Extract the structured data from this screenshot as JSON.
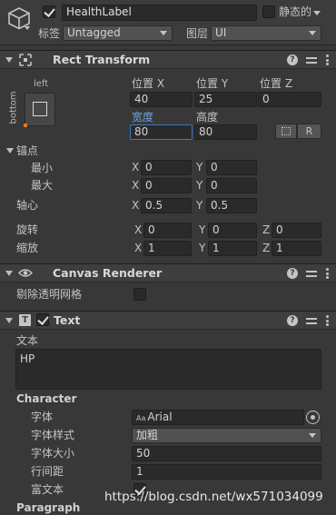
{
  "header": {
    "name_value": "HealthLabel",
    "static_label": "静态的",
    "tag_label": "标签",
    "tag_value": "Untagged",
    "layer_label": "图层",
    "layer_value": "UI"
  },
  "rect_transform": {
    "title": "Rect Transform",
    "anchor_preset_top": "left",
    "anchor_preset_side": "bottom",
    "pos_x_label": "位置 X",
    "pos_y_label": "位置 Y",
    "pos_z_label": "位置 Z",
    "pos_x": "40",
    "pos_y": "25",
    "pos_z": "0",
    "width_label": "宽度",
    "height_label": "高度",
    "width": "80",
    "height": "80",
    "raw_button": "R",
    "anchors_label": "锚点",
    "min_label": "最小",
    "max_label": "最大",
    "min_x": "0",
    "min_y": "0",
    "max_x": "0",
    "max_y": "0",
    "pivot_label": "轴心",
    "pivot_x": "0.5",
    "pivot_y": "0.5",
    "rotation_label": "旋转",
    "rot_x": "0",
    "rot_y": "0",
    "rot_z": "0",
    "scale_label": "缩放",
    "scale_x": "1",
    "scale_y": "1",
    "scale_z": "1",
    "axis_x": "X",
    "axis_y": "Y",
    "axis_z": "Z"
  },
  "canvas_renderer": {
    "title": "Canvas Renderer",
    "cull_label": "剔除透明网格"
  },
  "text_component": {
    "title": "Text",
    "text_label": "文本",
    "text_value": "HP",
    "character_section": "Character",
    "font_label": "字体",
    "font_value": "Arial",
    "font_icon_text": "Aa",
    "font_style_label": "字体样式",
    "font_style_value": "加粗",
    "font_size_label": "字体大小",
    "font_size_value": "50",
    "line_spacing_label": "行间距",
    "line_spacing_value": "1",
    "rich_text_label": "富文本",
    "paragraph_section": "Paragraph"
  },
  "watermark": "https://blog.csdn.net/wx571034099"
}
